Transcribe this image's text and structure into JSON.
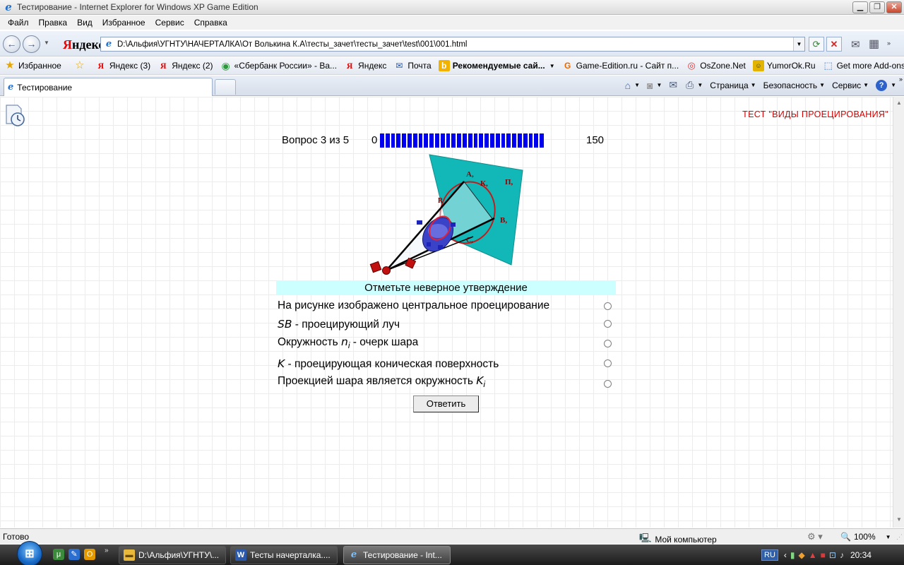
{
  "window": {
    "title": "Тестирование - Internet Explorer for Windows XP Game Edition",
    "controls": [
      "minimize-icon",
      "restore-icon",
      "close-icon"
    ]
  },
  "menu": [
    "Файл",
    "Правка",
    "Вид",
    "Избранное",
    "Сервис",
    "Справка"
  ],
  "address": {
    "brand": "Яндекс",
    "url": "D:\\Альфия\\УГНТУ\\НАЧЕРТАЛКА\\От Волькина К.А\\тесты_зачет\\тесты_зачет\\test\\001\\001.html"
  },
  "favorites": [
    {
      "label": "Избранное",
      "icon": "star-icon"
    },
    {
      "label": "",
      "icon": "add-favorite-icon"
    },
    {
      "label": "Яндекс (3)",
      "icon": "yandex-icon"
    },
    {
      "label": "Яндекс (2)",
      "icon": "yandex-icon"
    },
    {
      "label": "«Сбербанк России» - Ва...",
      "icon": "sberbank-icon"
    },
    {
      "label": "Яндекс",
      "icon": "yandex-icon"
    },
    {
      "label": "Почта",
      "icon": "mail-icon"
    },
    {
      "label": "Рекомендуемые сай...",
      "icon": "bing-icon"
    },
    {
      "label": "Game-Edition.ru - Сайт п...",
      "icon": "game-edition-icon"
    },
    {
      "label": "OsZone.Net",
      "icon": "oszone-icon"
    },
    {
      "label": "YumorOk.Ru",
      "icon": "yumorok-icon"
    },
    {
      "label": "Get more Add-ons",
      "icon": "addons-icon"
    }
  ],
  "tabs": [
    {
      "label": "Тестирование",
      "icon": "ie-page-icon"
    }
  ],
  "command_bar": {
    "page": "Страница",
    "safety": "Безопасность",
    "tools": "Сервис"
  },
  "test": {
    "title": "ТЕСТ \"ВИДЫ ПРОЕЦИРОВАНИЯ\"",
    "question_counter": "Вопрос 3 из 5",
    "progress_min": "0",
    "progress_max": "150",
    "progress_segments": 30,
    "progress_color": "#0000f0",
    "instruction": "Отметьте неверное утверждение",
    "options": [
      {
        "pre": "На рисунке изображено центральное проецирование",
        "sym": "",
        "sub": "",
        "post": ""
      },
      {
        "pre": "",
        "sym": "SB",
        "sub": "",
        "post": " - проецирующий луч"
      },
      {
        "pre": "Окружность ",
        "sym": "n",
        "sub": "i",
        "post": " - очерк шара"
      },
      {
        "pre": "",
        "sym": "K",
        "sub": "",
        "post": " - проецирующая коническая поверхность"
      },
      {
        "pre": "Проекцией шара является окружность ",
        "sym": "K",
        "sub": "i",
        "post": ""
      }
    ],
    "submit_label": "Ответить",
    "figure_labels": {
      "plane": "П,",
      "a": "А,",
      "k": "К,",
      "b": "В,",
      "c": "С,",
      "r": "R"
    },
    "colors": {
      "title": "#d60000",
      "instruction_bg": "#ccffff",
      "plane": "#12b8b8"
    }
  },
  "status": {
    "text": "Готово",
    "zone": "Мой компьютер",
    "zoom": "100%"
  },
  "taskbar": {
    "buttons": [
      {
        "label": "D:\\Альфия\\УГНТУ\\...",
        "icon": "folder-icon"
      },
      {
        "label": "Тесты начерталка....",
        "icon": "word-icon"
      },
      {
        "label": "Тестирование - Int...",
        "icon": "ie-icon"
      }
    ],
    "lang": "RU",
    "clock": "20:34"
  }
}
